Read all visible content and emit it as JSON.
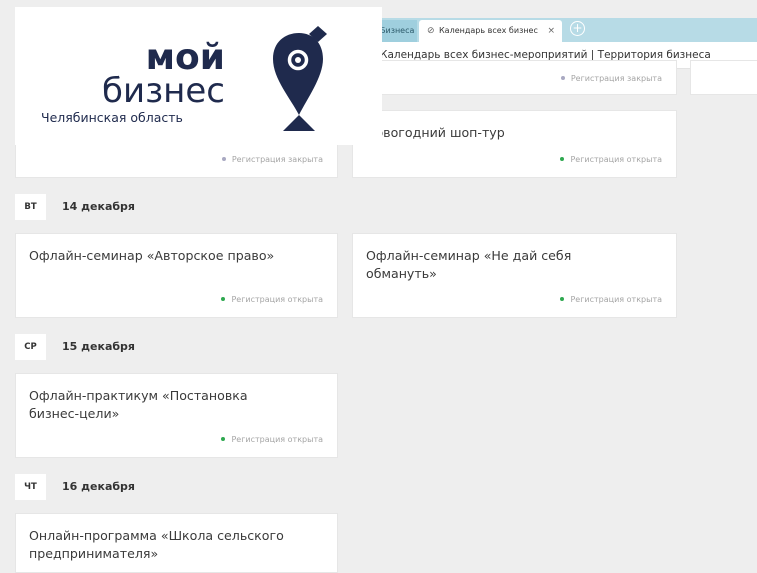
{
  "browser": {
    "tabs": [
      {
        "label": "Бизнеса"
      },
      {
        "label": "Календарь всех бизнес",
        "close": "×"
      }
    ],
    "new_tab": "+",
    "page_title": "Календарь всех бизнес-мероприятий | Территория бизнеса"
  },
  "logo": {
    "line1": "мой",
    "line2": "бизнес",
    "region": "Челябинская область",
    "colors": {
      "text": "#1f2a4d",
      "accent": "#1f2a4d"
    }
  },
  "status": {
    "open": "Регистрация открыта",
    "closed": "Регистрация закрыта"
  },
  "events_top": [
    {
      "title": "",
      "status": "Регистрация закрыта"
    },
    {
      "title": "Новогодний шоп-тур",
      "status": "Регистрация открыта"
    }
  ],
  "days": [
    {
      "weekday": "ВТ",
      "date": "14 декабря",
      "events": [
        {
          "title": "Офлайн-семинар «Авторское право»",
          "status": "Регистрация открыта"
        },
        {
          "title": "Офлайн-семинар «Не дай себя обмануть»",
          "status": "Регистрация открыта"
        }
      ]
    },
    {
      "weekday": "СР",
      "date": "15 декабря",
      "events": [
        {
          "title": "Офлайн-практикум «Постановка бизнес-цели»",
          "status": "Регистрация открыта"
        }
      ]
    },
    {
      "weekday": "ЧТ",
      "date": "16 декабря",
      "events": [
        {
          "title": "Онлайн-программа «Школа сельского предпринимателя»",
          "status": ""
        }
      ]
    }
  ]
}
